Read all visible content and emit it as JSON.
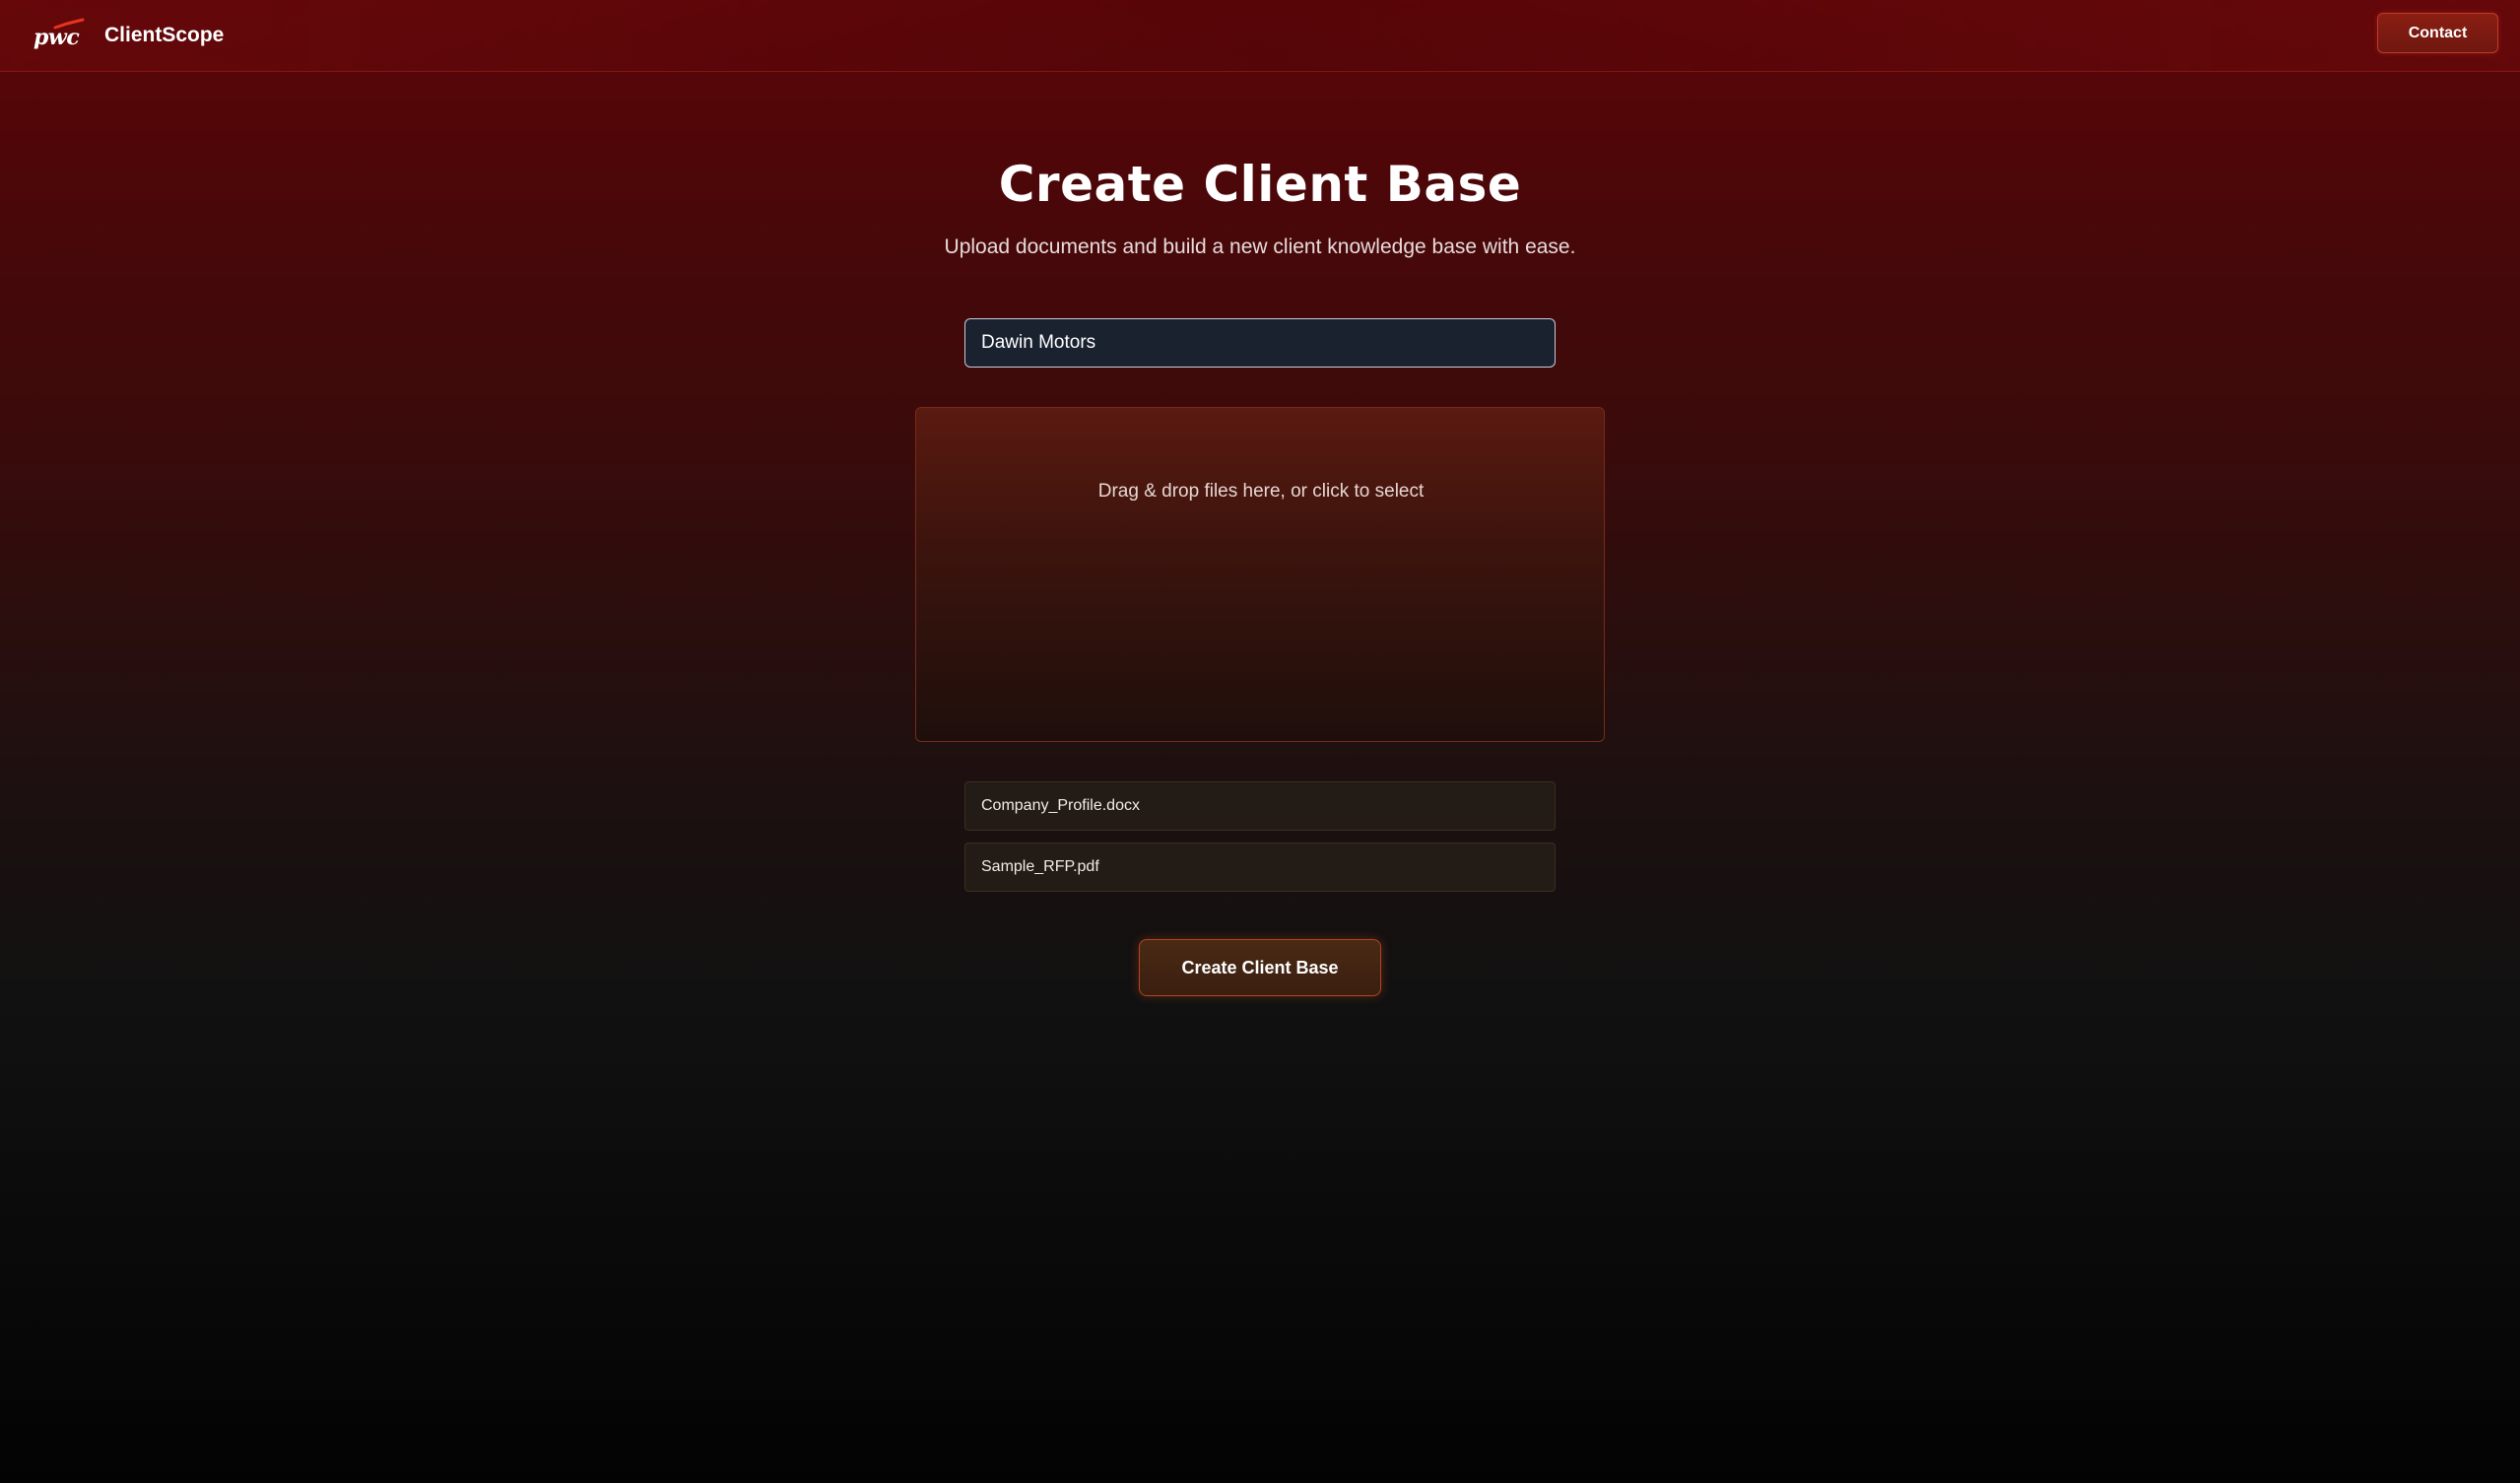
{
  "header": {
    "logo_text": "pwc",
    "app_name": "ClientScope",
    "contact_label": "Contact"
  },
  "main": {
    "title": "Create Client Base",
    "subtitle": "Upload documents and build a new client knowledge base with ease.",
    "client_name_value": "Dawin Motors",
    "dropzone_text": "Drag & drop files here, or click to select",
    "files": [
      {
        "name": "Company_Profile.docx"
      },
      {
        "name": "Sample_RFP.pdf"
      }
    ],
    "submit_label": "Create Client Base"
  },
  "colors": {
    "accent": "#c0392b",
    "logo_mark": "#e8331f"
  },
  "icons": [
    "pwc-logo"
  ]
}
